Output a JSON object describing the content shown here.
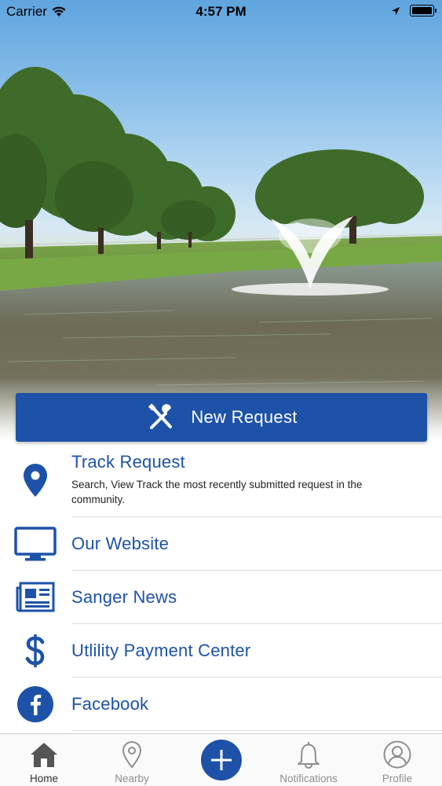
{
  "status_bar": {
    "carrier": "Carrier",
    "time": "4:57 PM"
  },
  "hero": {
    "image_icon": "park-pond-fountain"
  },
  "new_request": {
    "label": "New Request",
    "icon": "wrench-screwdriver-icon"
  },
  "menu": {
    "items": [
      {
        "title": "Track Request",
        "description": "Search, View Track the most recently submitted request in the community.",
        "icon": "map-pin-icon"
      },
      {
        "title": "Our Website",
        "icon": "monitor-icon"
      },
      {
        "title": "Sanger News",
        "icon": "newspaper-icon"
      },
      {
        "title": "Utlility Payment Center",
        "icon": "dollar-icon"
      },
      {
        "title": "Facebook",
        "icon": "facebook-icon"
      }
    ]
  },
  "tab_bar": {
    "tabs": [
      {
        "label": "Home",
        "icon": "home-icon",
        "active": true
      },
      {
        "label": "Nearby",
        "icon": "location-pin-icon",
        "active": false
      },
      {
        "label": "",
        "icon": "plus-icon",
        "active": false
      },
      {
        "label": "Notifications",
        "icon": "bell-icon",
        "active": false
      },
      {
        "label": "Profile",
        "icon": "person-icon",
        "active": false
      }
    ]
  },
  "colors": {
    "accent": "#1d52a8",
    "divider": "#dcdcdc",
    "tab_inactive": "#8e8e8e"
  }
}
